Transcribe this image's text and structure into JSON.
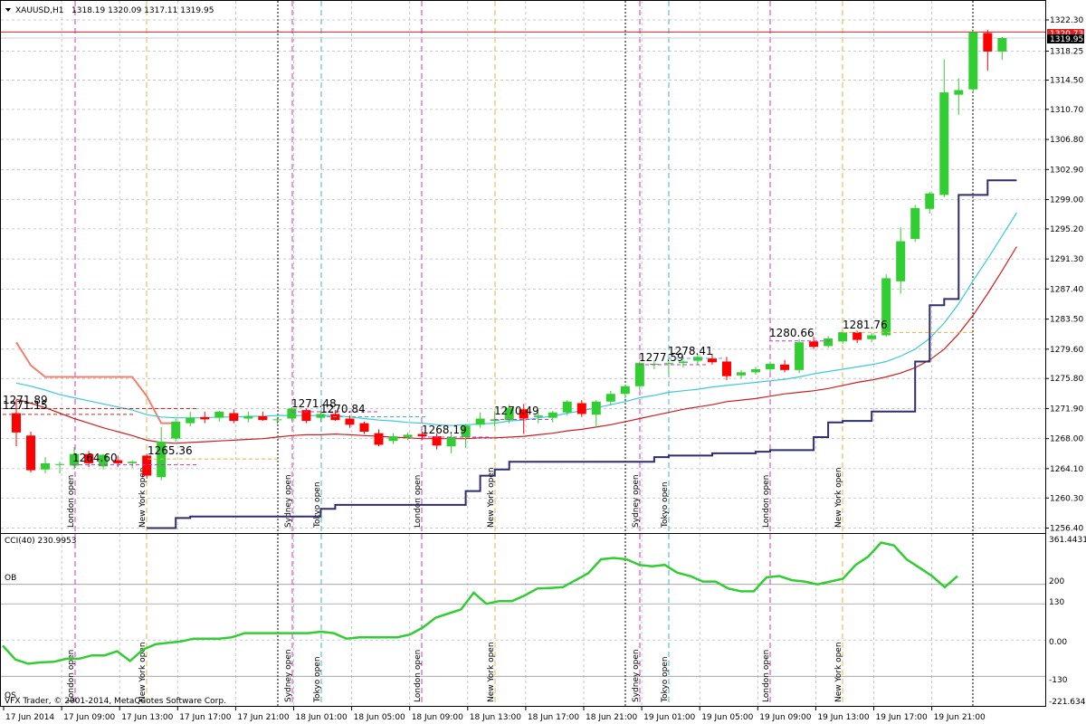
{
  "header": {
    "symbol": "XAUUSD,H1",
    "ohlc": "1318.19 1320.09 1317.11 1319.95"
  },
  "price_tags": {
    "ask": "1320.73",
    "bid": "1319.95"
  },
  "indicator": {
    "title": "CCI(40) 230.9953",
    "ob_label": "OB",
    "os_label": "OS",
    "scale": [
      "361.4431",
      "200",
      "130",
      "0.00",
      "-130",
      "-221.6349"
    ]
  },
  "copyright": "VFX Trader, © 2001-2014, MetaQuotes Software Corp.",
  "colors": {
    "bull": "#32cd32",
    "bear": "#ff0000",
    "kijun": "#2e2e6e",
    "cyan_ma": "#3cc8dc",
    "red_ma": "#cc1e1e",
    "salmon": "#f08070",
    "cci": "#32cd32",
    "grid": "#b4bcc8",
    "london": "#cc33cc",
    "newyork": "#e6b43c",
    "sydney": "#000000",
    "tokyo": "#3cb4c8"
  },
  "session_labels": {
    "london": "London open",
    "newyork": "New York open",
    "sydney": "Sydney open",
    "tokyo": "Tokyo open"
  },
  "chart_data": {
    "type": "candlestick",
    "price_axis": [
      "1322.30",
      "1318.25",
      "1314.50",
      "1310.70",
      "1306.80",
      "1302.90",
      "1299.00",
      "1295.20",
      "1291.30",
      "1287.40",
      "1283.50",
      "1279.60",
      "1275.80",
      "1271.90",
      "1268.00",
      "1264.10",
      "1260.30",
      "1256.40"
    ],
    "ylim": [
      1256.4,
      1322.3
    ],
    "time_axis": [
      "17 Jun 2014",
      "17 Jun 09:00",
      "17 Jun 13:00",
      "17 Jun 17:00",
      "17 Jun 21:00",
      "18 Jun 01:00",
      "18 Jun 05:00",
      "18 Jun 09:00",
      "18 Jun 13:00",
      "18 Jun 17:00",
      "18 Jun 21:00",
      "19 Jun 01:00",
      "19 Jun 05:00",
      "19 Jun 09:00",
      "19 Jun 13:00",
      "19 Jun 17:00",
      "19 Jun 21:00"
    ],
    "candles": [
      {
        "o": 1271.3,
        "h": 1273.0,
        "l": 1267.0,
        "c": 1268.8
      },
      {
        "o": 1268.4,
        "h": 1268.9,
        "l": 1263.6,
        "c": 1263.9
      },
      {
        "o": 1264.0,
        "h": 1265.6,
        "l": 1263.5,
        "c": 1264.8
      },
      {
        "o": 1264.6,
        "h": 1265.0,
        "l": 1263.5,
        "c": 1264.7
      },
      {
        "o": 1264.5,
        "h": 1266.9,
        "l": 1264.0,
        "c": 1266.0
      },
      {
        "o": 1266.0,
        "h": 1266.4,
        "l": 1264.3,
        "c": 1264.8
      },
      {
        "o": 1264.4,
        "h": 1266.0,
        "l": 1264.0,
        "c": 1265.9
      },
      {
        "o": 1265.2,
        "h": 1265.8,
        "l": 1264.3,
        "c": 1264.8
      },
      {
        "o": 1264.8,
        "h": 1265.2,
        "l": 1264.2,
        "c": 1265.0
      },
      {
        "o": 1265.8,
        "h": 1266.0,
        "l": 1262.8,
        "c": 1263.2
      },
      {
        "o": 1263.0,
        "h": 1269.5,
        "l": 1262.6,
        "c": 1267.6
      },
      {
        "o": 1268.0,
        "h": 1270.6,
        "l": 1267.6,
        "c": 1270.2
      },
      {
        "o": 1270.0,
        "h": 1271.5,
        "l": 1269.6,
        "c": 1270.7
      },
      {
        "o": 1270.8,
        "h": 1271.5,
        "l": 1270.0,
        "c": 1270.5
      },
      {
        "o": 1270.7,
        "h": 1271.6,
        "l": 1270.2,
        "c": 1271.5
      },
      {
        "o": 1271.3,
        "h": 1271.8,
        "l": 1270.0,
        "c": 1270.3
      },
      {
        "o": 1270.6,
        "h": 1271.5,
        "l": 1270.1,
        "c": 1270.9
      },
      {
        "o": 1270.9,
        "h": 1271.5,
        "l": 1270.3,
        "c": 1270.4
      },
      {
        "o": 1270.4,
        "h": 1270.8,
        "l": 1269.9,
        "c": 1270.5
      },
      {
        "o": 1270.6,
        "h": 1272.1,
        "l": 1270.3,
        "c": 1271.9
      },
      {
        "o": 1271.7,
        "h": 1271.9,
        "l": 1270.0,
        "c": 1270.3
      },
      {
        "o": 1270.7,
        "h": 1271.6,
        "l": 1270.2,
        "c": 1271.2
      },
      {
        "o": 1271.2,
        "h": 1271.7,
        "l": 1270.3,
        "c": 1270.4
      },
      {
        "o": 1270.6,
        "h": 1271.0,
        "l": 1269.4,
        "c": 1269.8
      },
      {
        "o": 1270.0,
        "h": 1270.2,
        "l": 1268.6,
        "c": 1268.9
      },
      {
        "o": 1268.7,
        "h": 1269.2,
        "l": 1267.0,
        "c": 1267.2
      },
      {
        "o": 1267.7,
        "h": 1268.7,
        "l": 1267.3,
        "c": 1268.3
      },
      {
        "o": 1268.2,
        "h": 1268.8,
        "l": 1267.8,
        "c": 1268.5
      },
      {
        "o": 1268.6,
        "h": 1268.9,
        "l": 1267.9,
        "c": 1268.3
      },
      {
        "o": 1268.3,
        "h": 1268.7,
        "l": 1266.6,
        "c": 1267.1
      },
      {
        "o": 1267.0,
        "h": 1268.7,
        "l": 1266.1,
        "c": 1268.2
      },
      {
        "o": 1268.2,
        "h": 1269.9,
        "l": 1266.8,
        "c": 1269.7
      },
      {
        "o": 1269.8,
        "h": 1271.4,
        "l": 1269.4,
        "c": 1270.6
      },
      {
        "o": 1270.3,
        "h": 1271.5,
        "l": 1269.6,
        "c": 1270.5
      },
      {
        "o": 1270.4,
        "h": 1272.4,
        "l": 1270.0,
        "c": 1272.0
      },
      {
        "o": 1271.8,
        "h": 1272.5,
        "l": 1268.6,
        "c": 1270.6
      },
      {
        "o": 1270.8,
        "h": 1271.4,
        "l": 1270.0,
        "c": 1271.0
      },
      {
        "o": 1270.7,
        "h": 1271.6,
        "l": 1270.1,
        "c": 1271.4
      },
      {
        "o": 1271.4,
        "h": 1273.0,
        "l": 1271.0,
        "c": 1272.8
      },
      {
        "o": 1272.6,
        "h": 1273.0,
        "l": 1270.8,
        "c": 1271.2
      },
      {
        "o": 1271.1,
        "h": 1273.0,
        "l": 1269.4,
        "c": 1272.8
      },
      {
        "o": 1272.8,
        "h": 1274.2,
        "l": 1272.3,
        "c": 1273.8
      },
      {
        "o": 1273.8,
        "h": 1275.0,
        "l": 1273.2,
        "c": 1274.8
      },
      {
        "o": 1274.8,
        "h": 1278.0,
        "l": 1274.3,
        "c": 1277.8
      },
      {
        "o": 1277.6,
        "h": 1278.2,
        "l": 1277.0,
        "c": 1277.7
      },
      {
        "o": 1277.7,
        "h": 1278.2,
        "l": 1276.4,
        "c": 1277.8
      },
      {
        "o": 1277.8,
        "h": 1278.2,
        "l": 1277.2,
        "c": 1278.0
      },
      {
        "o": 1278.1,
        "h": 1278.9,
        "l": 1277.6,
        "c": 1278.6
      },
      {
        "o": 1278.4,
        "h": 1279.0,
        "l": 1277.6,
        "c": 1277.9
      },
      {
        "o": 1278.0,
        "h": 1278.6,
        "l": 1275.6,
        "c": 1276.1
      },
      {
        "o": 1276.2,
        "h": 1276.9,
        "l": 1275.8,
        "c": 1276.6
      },
      {
        "o": 1276.6,
        "h": 1277.3,
        "l": 1276.3,
        "c": 1277.0
      },
      {
        "o": 1277.0,
        "h": 1278.0,
        "l": 1276.6,
        "c": 1277.7
      },
      {
        "o": 1277.6,
        "h": 1278.2,
        "l": 1276.6,
        "c": 1276.9
      },
      {
        "o": 1276.9,
        "h": 1280.9,
        "l": 1276.5,
        "c": 1280.5
      },
      {
        "o": 1280.6,
        "h": 1281.2,
        "l": 1279.6,
        "c": 1279.9
      },
      {
        "o": 1280.0,
        "h": 1281.3,
        "l": 1279.8,
        "c": 1281.0
      },
      {
        "o": 1280.6,
        "h": 1282.0,
        "l": 1280.3,
        "c": 1281.8
      },
      {
        "o": 1281.8,
        "h": 1282.0,
        "l": 1280.4,
        "c": 1280.8
      },
      {
        "o": 1280.9,
        "h": 1281.7,
        "l": 1280.5,
        "c": 1281.4
      },
      {
        "o": 1281.4,
        "h": 1289.3,
        "l": 1281.2,
        "c": 1288.8
      },
      {
        "o": 1288.4,
        "h": 1295.4,
        "l": 1286.8,
        "c": 1293.6
      },
      {
        "o": 1293.9,
        "h": 1298.3,
        "l": 1293.5,
        "c": 1297.9
      },
      {
        "o": 1297.8,
        "h": 1300.0,
        "l": 1297.2,
        "c": 1299.8
      },
      {
        "o": 1299.6,
        "h": 1317.2,
        "l": 1299.3,
        "c": 1312.9
      },
      {
        "o": 1312.6,
        "h": 1314.7,
        "l": 1310.0,
        "c": 1313.2
      },
      {
        "o": 1313.3,
        "h": 1320.9,
        "l": 1312.8,
        "c": 1320.7
      },
      {
        "o": 1320.6,
        "h": 1321.0,
        "l": 1315.7,
        "c": 1318.2
      },
      {
        "o": 1318.2,
        "h": 1320.1,
        "l": 1317.1,
        "c": 1319.95
      }
    ],
    "kijun": [
      null,
      null,
      null,
      null,
      null,
      null,
      null,
      null,
      null,
      1256.4,
      1256.4,
      1257.7,
      1257.9,
      1257.9,
      1257.9,
      1257.9,
      1257.9,
      1257.9,
      1257.9,
      1257.9,
      1257.9,
      1258.9,
      1259.4,
      1259.4,
      1259.4,
      1259.4,
      1259.4,
      1259.4,
      1259.4,
      1259.4,
      1259.4,
      1261.2,
      1263.2,
      1264.0,
      1265.0,
      1265.0,
      1265.0,
      1265.0,
      1265.0,
      1265.0,
      1265.0,
      1265.0,
      1265.0,
      1265.0,
      1265.6,
      1265.8,
      1265.8,
      1265.8,
      1266.1,
      1266.1,
      1266.1,
      1266.3,
      1266.5,
      1266.5,
      1266.5,
      1268.2,
      1270.1,
      1270.3,
      1270.3,
      1271.5,
      1271.5,
      1271.5,
      1278.0,
      1285.3,
      1286.1,
      1299.6,
      1299.6,
      1301.5,
      1301.5,
      1301.5
    ],
    "ma_cyan": [
      1275.2,
      1274.8,
      1274.3,
      1273.7,
      1273.3,
      1272.9,
      1272.5,
      1272.1,
      1271.7,
      1271.1,
      1270.8,
      1270.7,
      1270.7,
      1270.7,
      1270.8,
      1270.8,
      1270.9,
      1270.9,
      1271.0,
      1271.0,
      1271.0,
      1271.0,
      1271.0,
      1270.8,
      1270.6,
      1270.4,
      1270.3,
      1270.1,
      1270.0,
      1269.8,
      1269.7,
      1269.8,
      1269.9,
      1270.0,
      1270.3,
      1270.4,
      1270.7,
      1270.9,
      1271.3,
      1271.6,
      1272.0,
      1272.4,
      1272.8,
      1273.3,
      1273.6,
      1274.0,
      1274.2,
      1274.4,
      1274.7,
      1274.9,
      1275.1,
      1275.3,
      1275.5,
      1275.7,
      1276.0,
      1276.4,
      1276.7,
      1277.0,
      1277.3,
      1277.6,
      1278.0,
      1278.7,
      1279.6,
      1281.0,
      1283.0,
      1285.5,
      1288.5,
      1291.3,
      1294.3,
      1297.3
    ],
    "ma_red": [
      1273.1,
      1272.6,
      1272.0,
      1271.3,
      1270.6,
      1270.0,
      1269.4,
      1268.9,
      1268.4,
      1267.8,
      1267.5,
      1267.4,
      1267.5,
      1267.6,
      1267.7,
      1267.8,
      1267.9,
      1268.0,
      1268.2,
      1268.4,
      1268.5,
      1268.5,
      1268.6,
      1268.5,
      1268.4,
      1268.3,
      1268.2,
      1268.1,
      1268.0,
      1268.0,
      1268.0,
      1268.0,
      1268.1,
      1268.1,
      1268.2,
      1268.3,
      1268.5,
      1268.7,
      1269.0,
      1269.2,
      1269.5,
      1269.8,
      1270.2,
      1270.6,
      1271.0,
      1271.4,
      1271.8,
      1272.1,
      1272.4,
      1272.8,
      1273.0,
      1273.2,
      1273.5,
      1273.8,
      1274.0,
      1274.2,
      1274.5,
      1274.9,
      1275.3,
      1275.6,
      1276.0,
      1276.5,
      1277.2,
      1278.2,
      1279.6,
      1281.6,
      1284.0,
      1286.8,
      1289.8,
      1292.9
    ],
    "salmon_line": [
      1280.5,
      1277.5,
      1276.0,
      1276.0,
      1276.0,
      1276.0,
      1276.0,
      1276.0,
      1276.0,
      1273.5,
      1270.0,
      1270.0
    ],
    "price_annotations": [
      "1271.89",
      "1271.15",
      "1264.60",
      "1265.36",
      "1271.48",
      "1270.84",
      "1268.19",
      "1270.49",
      "1277.59",
      "1278.41",
      "1280.66",
      "1281.76"
    ],
    "cci": [
      -20,
      -70,
      -85,
      -80,
      -78,
      -67,
      -67,
      -55,
      -55,
      -40,
      -75,
      -35,
      -15,
      -10,
      -5,
      5,
      5,
      5,
      10,
      25,
      25,
      25,
      25,
      25,
      25,
      30,
      25,
      5,
      10,
      10,
      10,
      10,
      20,
      45,
      80,
      95,
      110,
      170,
      130,
      140,
      140,
      160,
      185,
      187,
      190,
      215,
      240,
      290,
      295,
      290,
      270,
      265,
      270,
      242,
      230,
      210,
      210,
      185,
      175,
      175,
      225,
      230,
      215,
      210,
      200,
      210,
      220,
      270,
      300,
      350,
      340,
      290,
      260,
      230,
      190,
      230
    ],
    "cci_ylim": [
      -221.6349,
      361.4431
    ],
    "cci_levels": [
      200,
      130,
      0,
      -130
    ]
  }
}
